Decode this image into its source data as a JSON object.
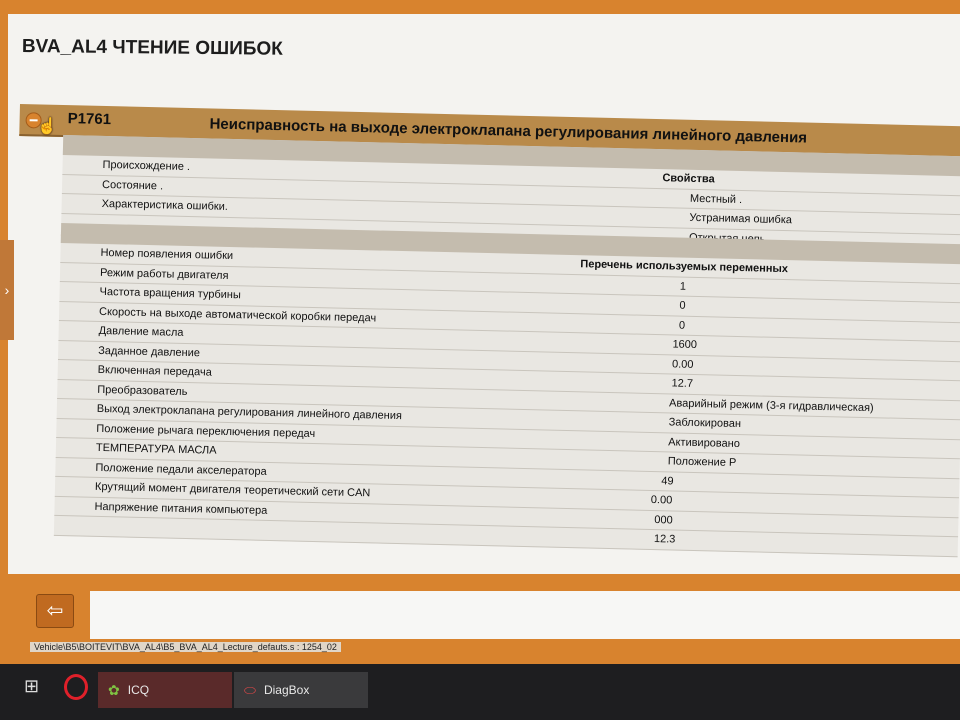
{
  "window": {
    "title": "BVA_AL4  ЧТЕНИЕ ОШИБОК",
    "left_tab_glyph": "›"
  },
  "fault": {
    "code": "P1761",
    "description": "Неисправность на выходе электроклапана регулирования линейного давления"
  },
  "properties": {
    "value_header": "Свойства",
    "rows": [
      {
        "label": "Происхождение .",
        "value": ""
      },
      {
        "label": "Состояние .",
        "value": "Местный ."
      },
      {
        "label": "Характеристика ошибки.",
        "value": "Устранимая ошибка"
      },
      {
        "label": "",
        "value": "Открытая цепь"
      }
    ]
  },
  "variables": {
    "value_header": "Перечень используемых переменных",
    "rows": [
      {
        "label": "Номер появления ошибки",
        "value": ""
      },
      {
        "label": "Режим работы двигателя",
        "value": "1"
      },
      {
        "label": "Частота вращения турбины",
        "value": "0"
      },
      {
        "label": "Скорость на выходе автоматической коробки передач",
        "value": "0"
      },
      {
        "label": "Давление масла",
        "value": "1600"
      },
      {
        "label": "Заданное давление",
        "value": "0.00"
      },
      {
        "label": "Включенная передача",
        "value": "12.7"
      },
      {
        "label": "Преобразователь",
        "value": "Аварийный режим (3-я гидравлическая)"
      },
      {
        "label": "Выход электроклапана регулирования линейного давления",
        "value": "Заблокирован"
      },
      {
        "label": "Положение рычага переключения передач",
        "value": "Активировано"
      },
      {
        "label": "ТЕМПЕРАТУРА МАСЛА",
        "value": "Положение P"
      },
      {
        "label": "Положение педали акселератора",
        "value": "49"
      },
      {
        "label": "Крутящий момент двигателя теоретический сети CAN",
        "value": "0.00"
      },
      {
        "label": "Напряжение питания компьютера",
        "value": "000"
      },
      {
        "label": "",
        "value": "12.3"
      }
    ]
  },
  "footer": {
    "back_glyph": "⇦",
    "path": "Vehicle\\B5\\BOITEVIT\\BVA_AL4\\B5_BVA_AL4_Lecture_defauts.s : 1254_02"
  },
  "taskbar": {
    "start_glyph": "⊞",
    "items": [
      {
        "label": "ICQ",
        "icon": "icq-flower-icon"
      },
      {
        "label": "DiagBox",
        "icon": "diagbox-icon"
      }
    ]
  },
  "colors": {
    "accent": "#d8832e",
    "header_band": "#b98a4a",
    "panel_band": "#c4bcae"
  }
}
